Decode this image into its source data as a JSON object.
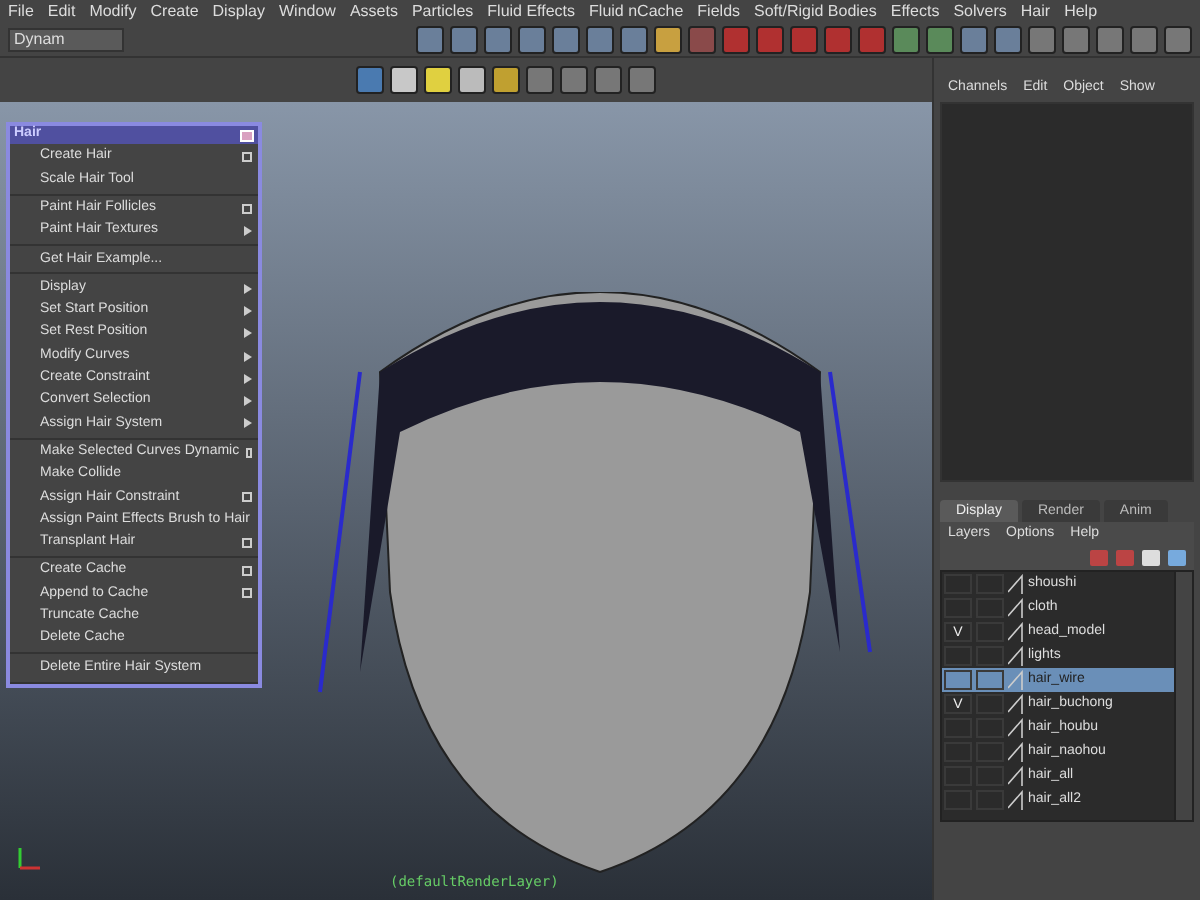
{
  "menu_bar": [
    "File",
    "Edit",
    "Modify",
    "Create",
    "Display",
    "Window",
    "Assets",
    "Particles",
    "Fluid Effects",
    "Fluid nCache",
    "Fields",
    "Soft/Rigid Bodies",
    "Effects",
    "Solvers",
    "Hair",
    "Help"
  ],
  "toolbar": {
    "menu_set": "Dynam"
  },
  "viewport": {
    "camera_label": "(defaultRenderLayer)"
  },
  "hair_menu": {
    "title": "Hair",
    "groups": [
      [
        {
          "label": "Create Hair",
          "kind": "option"
        },
        {
          "label": "Scale Hair Tool",
          "kind": "plain"
        }
      ],
      [
        {
          "label": "Paint Hair Follicles",
          "kind": "option"
        },
        {
          "label": "Paint Hair Textures",
          "kind": "submenu"
        }
      ],
      [
        {
          "label": "Get Hair Example...",
          "kind": "plain"
        }
      ],
      [
        {
          "label": "Display",
          "kind": "submenu"
        },
        {
          "label": "Set Start Position",
          "kind": "submenu"
        },
        {
          "label": "Set Rest Position",
          "kind": "submenu"
        },
        {
          "label": "Modify Curves",
          "kind": "submenu"
        },
        {
          "label": "Create Constraint",
          "kind": "submenu"
        },
        {
          "label": "Convert Selection",
          "kind": "submenu"
        },
        {
          "label": "Assign Hair System",
          "kind": "submenu"
        }
      ],
      [
        {
          "label": "Make Selected Curves Dynamic",
          "kind": "option"
        },
        {
          "label": "Make Collide",
          "kind": "plain"
        },
        {
          "label": "Assign Hair Constraint",
          "kind": "option"
        },
        {
          "label": "Assign Paint Effects Brush to Hair",
          "kind": "plain"
        },
        {
          "label": "Transplant Hair",
          "kind": "option"
        }
      ],
      [
        {
          "label": "Create Cache",
          "kind": "option"
        },
        {
          "label": "Append to Cache",
          "kind": "option"
        },
        {
          "label": "Truncate Cache",
          "kind": "plain"
        },
        {
          "label": "Delete Cache",
          "kind": "plain"
        }
      ],
      [
        {
          "label": "Delete Entire Hair System",
          "kind": "plain"
        }
      ]
    ]
  },
  "channel_box": {
    "menu": [
      "Channels",
      "Edit",
      "Object",
      "Show"
    ]
  },
  "layer_editor": {
    "tabs": [
      {
        "label": "Display",
        "selected": true
      },
      {
        "label": "Render",
        "selected": false
      },
      {
        "label": "Anim",
        "selected": false
      }
    ],
    "menu": [
      "Layers",
      "Options",
      "Help"
    ],
    "layers": [
      {
        "name": "shoushi",
        "selected": false
      },
      {
        "name": "cloth",
        "selected": false
      },
      {
        "name": "head_model",
        "visibility": "V",
        "selected": false
      },
      {
        "name": "lights",
        "selected": false
      },
      {
        "name": "hair_wire",
        "selected": true
      },
      {
        "name": "hair_buchong",
        "visibility": "V",
        "selected": false
      },
      {
        "name": "hair_houbu",
        "selected": false
      },
      {
        "name": "hair_naohou",
        "selected": false
      },
      {
        "name": "hair_all",
        "selected": false
      },
      {
        "name": "hair_all2",
        "selected": false
      }
    ]
  }
}
